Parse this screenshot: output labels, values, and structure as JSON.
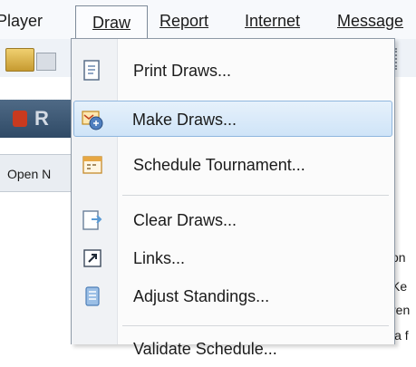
{
  "menubar": {
    "items": [
      {
        "label": "Player",
        "underline": ""
      },
      {
        "label": "Draw",
        "underline": "D"
      },
      {
        "label": "Report",
        "underline": "R"
      },
      {
        "label": "Internet",
        "underline": "I"
      },
      {
        "label": "Message",
        "underline": "M"
      }
    ]
  },
  "background": {
    "title_letter": "R",
    "open_label": "Open N",
    "right_fragments": [
      "on",
      "Ke",
      "ren",
      "la f"
    ]
  },
  "draw_menu": {
    "items": [
      {
        "label": "Print Draws...",
        "icon": "print-draws-icon",
        "highlighted": false
      },
      {
        "label": "Make Draws...",
        "icon": "make-draws-icon",
        "highlighted": true
      },
      {
        "label": "Schedule Tournament...",
        "icon": "schedule-tournament-icon",
        "highlighted": false
      },
      {
        "label": "Clear Draws...",
        "icon": "clear-draws-icon",
        "highlighted": false
      },
      {
        "label": "Links...",
        "icon": "links-icon",
        "highlighted": false
      },
      {
        "label": "Adjust Standings...",
        "icon": "adjust-standings-icon",
        "highlighted": false
      },
      {
        "label": "Validate Schedule...",
        "icon": "",
        "highlighted": false
      }
    ]
  },
  "colors": {
    "highlight": "#cfe4f8",
    "highlight_border": "#8fb6de",
    "menu_border": "#8e99a6"
  }
}
